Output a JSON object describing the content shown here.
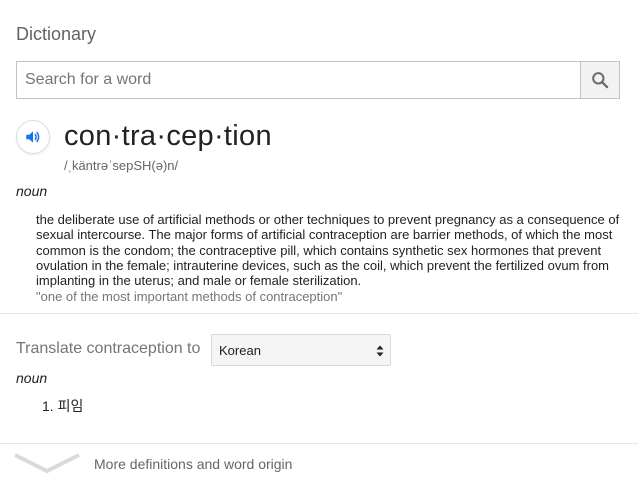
{
  "header": {
    "title": "Dictionary"
  },
  "search": {
    "placeholder": "Search for a word",
    "value": "",
    "icon": "search-icon"
  },
  "entry": {
    "speaker_icon": "speaker-icon",
    "headword": "con·tra·cep·tion",
    "phonetic": "/ˌkäntrəˈsepSH(ə)n/",
    "part_of_speech": "noun",
    "definition": "the deliberate use of artificial methods or other techniques to prevent pregnancy as a consequence of sexual intercourse. The major forms of artificial contraception are barrier methods, of which the most common is the condom; the contraceptive pill, which contains synthetic sex hormones that prevent ovulation in the female; intrauterine devices, such as the coil, which prevent the fertilized ovum from implanting in the uterus; and male or female sterilization.",
    "example": "\"one of the most important methods of contraception\""
  },
  "translate": {
    "label": "Translate contraception to",
    "selected_language": "Korean",
    "part_of_speech": "noun",
    "items": [
      {
        "number": "1.",
        "text": "피임"
      }
    ]
  },
  "footer": {
    "more_label": "More definitions and word origin",
    "chevron_icon": "chevron-down-icon"
  },
  "colors": {
    "speaker_blue": "#1a73e8",
    "muted_text": "#757575",
    "divider": "#e8e8e8"
  }
}
